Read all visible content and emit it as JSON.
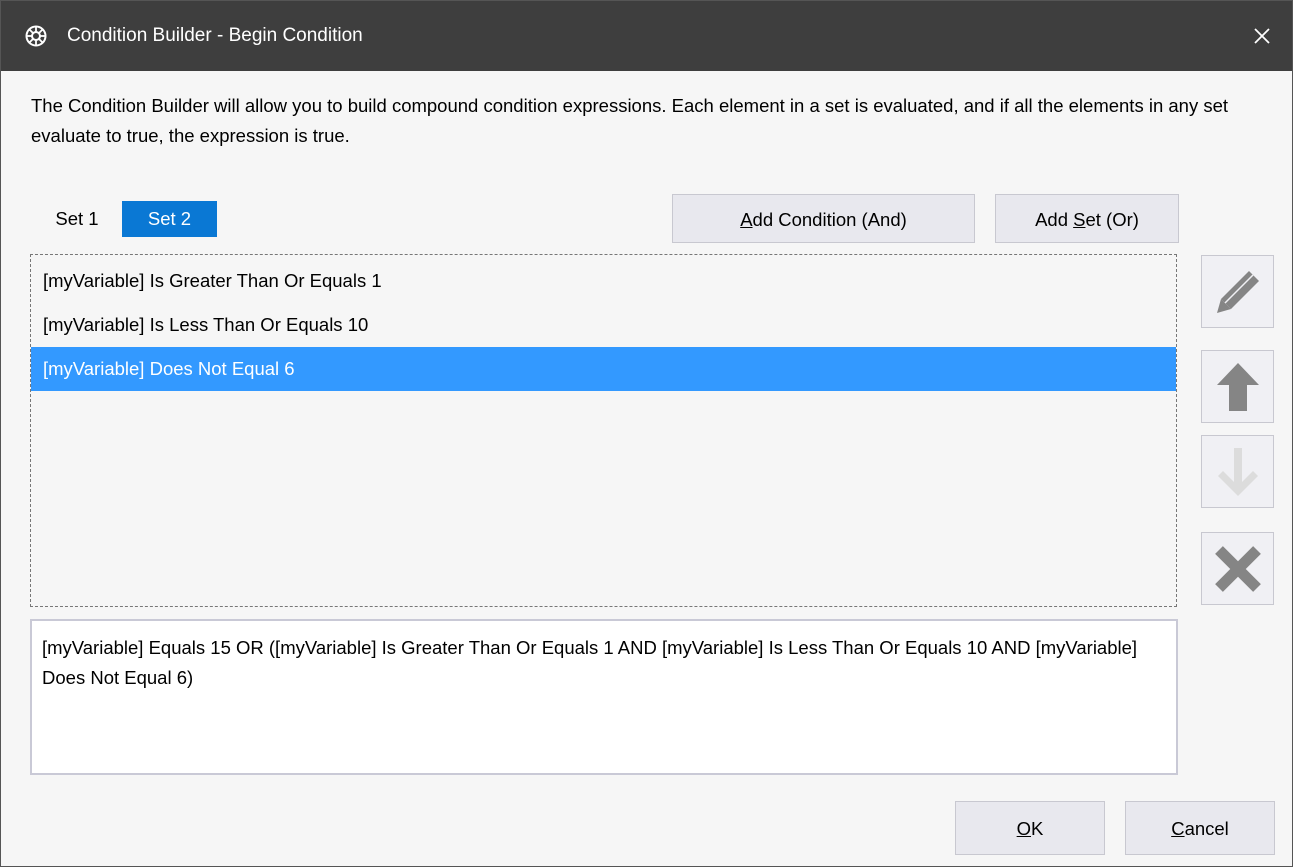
{
  "window": {
    "title": "Condition Builder - Begin Condition",
    "close_symbol": "✕",
    "app_icon": "gear-wheel-icon"
  },
  "description": "The Condition Builder will allow you to build compound condition expressions.  Each element in a set is evaluated, and if all the elements in any set evaluate to true, the expression is true.",
  "tabs": [
    {
      "label": "Set 1",
      "selected": false
    },
    {
      "label": "Set 2",
      "selected": true
    }
  ],
  "toolbar": {
    "add_condition": {
      "accel": "A",
      "rest": "dd Condition (And)"
    },
    "add_set": {
      "before": "Add ",
      "accel": "S",
      "rest": "et (Or)"
    }
  },
  "conditions": [
    {
      "text": "[myVariable] Is Greater Than Or Equals 1",
      "selected": false
    },
    {
      "text": "[myVariable] Is Less Than Or Equals 10",
      "selected": false
    },
    {
      "text": "[myVariable] Does Not Equal 6",
      "selected": true
    }
  ],
  "side_buttons": [
    {
      "icon": "pencil-icon",
      "enabled": true
    },
    {
      "icon": "arrow-up-icon",
      "enabled": true
    },
    {
      "icon": "arrow-down-icon",
      "enabled": false
    },
    {
      "icon": "delete-x-icon",
      "enabled": true
    }
  ],
  "expression": "[myVariable] Equals 15 OR ([myVariable] Is Greater Than Or Equals 1 AND [myVariable] Is Less Than Or Equals 10 AND [myVariable] Does Not Equal 6)",
  "footer": {
    "ok": {
      "accel": "O",
      "rest": "K"
    },
    "cancel": {
      "accel": "C",
      "rest": "ancel"
    }
  },
  "colors": {
    "titlebar": "#3e3e3e",
    "accent": "#0a78d4",
    "selection": "#3399ff",
    "icon_enabled": "#858585",
    "icon_disabled": "#dcdcdc"
  }
}
